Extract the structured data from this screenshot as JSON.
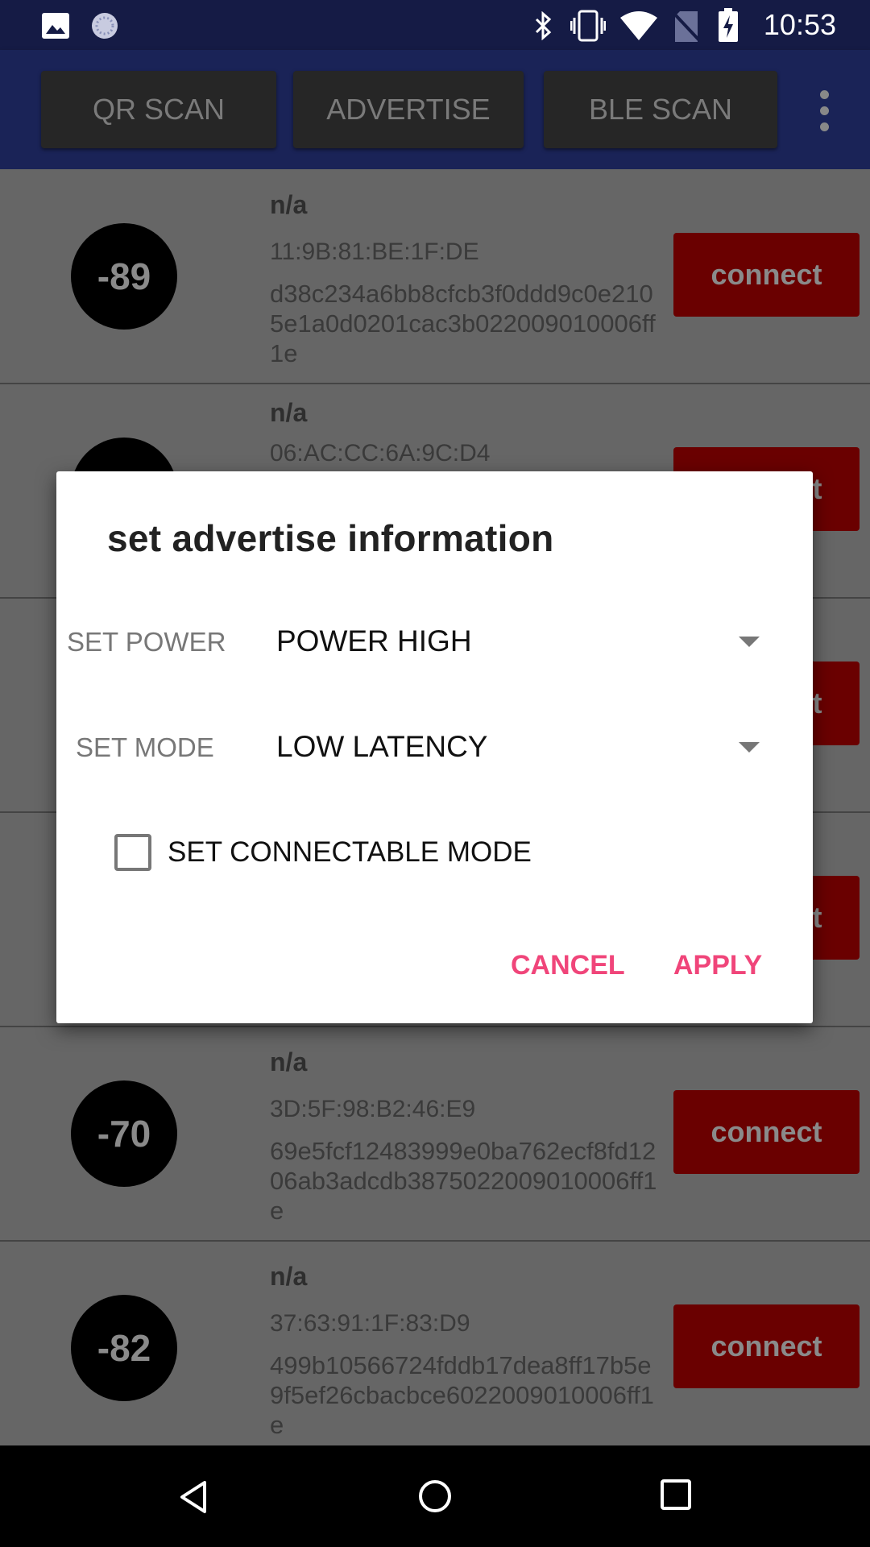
{
  "status_bar": {
    "time": "10:53",
    "icons": [
      "image-icon",
      "sync-icon",
      "bluetooth-icon",
      "vibrate-icon",
      "wifi-icon",
      "no-sim-icon",
      "battery-charging-icon"
    ]
  },
  "toolbar": {
    "buttons": [
      "QR SCAN",
      "ADVERTISE",
      "BLE SCAN"
    ],
    "menu_icon": "more-vert-icon"
  },
  "devices": [
    {
      "rssi": "-89",
      "name": "n/a",
      "mac": "11:9B:81:BE:1F:DE",
      "data": "d38c234a6bb8cfcb3f0ddd9c0e2105e1a0d0201cac3b022009010006ff1e",
      "action": "connect"
    },
    {
      "rssi": "",
      "name": "n/a",
      "mac": "06:AC:CC:6A:9C:D4",
      "data": "",
      "action": "connect"
    },
    {
      "rssi": "",
      "name": "",
      "mac": "",
      "data": "",
      "action": "connect"
    },
    {
      "rssi": "",
      "name": "",
      "mac": "",
      "data": "",
      "action": "connect"
    },
    {
      "rssi": "-70",
      "name": "n/a",
      "mac": "3D:5F:98:B2:46:E9",
      "data": "69e5fcf12483999e0ba762ecf8fd1206ab3adcdb3875022009010006ff1e",
      "action": "connect"
    },
    {
      "rssi": "-82",
      "name": "n/a",
      "mac": "37:63:91:1F:83:D9",
      "data": "499b10566724fddb17dea8ff17b5e9f5ef26cbacbce6022009010006ff1e",
      "action": "connect"
    }
  ],
  "dialog": {
    "title": "set advertise information",
    "power_label": "SET POWER",
    "power_value": "POWER HIGH",
    "mode_label": "SET MODE",
    "mode_value": "LOW LATENCY",
    "connectable_label": "SET CONNECTABLE MODE",
    "connectable_checked": false,
    "cancel": "CANCEL",
    "apply": "APPLY",
    "accent": "#f0457a"
  },
  "colors": {
    "app_bar": "#1a2357",
    "connect_button": "#e00000"
  }
}
